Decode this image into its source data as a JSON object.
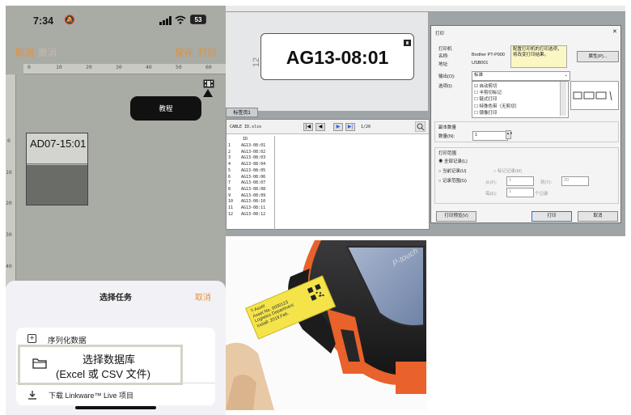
{
  "phone": {
    "status": {
      "time": "7:34",
      "battery": "53"
    },
    "toolbar": {
      "cancel": "取消",
      "undo": "撤消",
      "save": "保存",
      "print": "打印"
    },
    "ruler_h": [
      "0",
      "10",
      "20",
      "30",
      "40",
      "50",
      "60"
    ],
    "ruler_v": [
      "0",
      "10",
      "20",
      "30",
      "40"
    ],
    "tooltip": "教程",
    "label_text": "AD07-15:01",
    "sheet": {
      "title": "选择任务",
      "cancel": "取消",
      "options": [
        {
          "label": "序列化数据"
        },
        {
          "label": "选择数据库",
          "sub": "(Excel 或 CSV 文件)"
        },
        {
          "label": "下载 Linkware™ Live 项目"
        }
      ]
    }
  },
  "desktop": {
    "ruler_num": "12",
    "label_text": "AG13-08:01",
    "tab": "标签页1",
    "file_name": "CABLE ID.xlsx",
    "page_counter": "1/20",
    "table": {
      "header": "ID",
      "rows": [
        [
          "1",
          "AG13-08:01"
        ],
        [
          "2",
          "AG13-08:02"
        ],
        [
          "3",
          "AG13-08:03"
        ],
        [
          "4",
          "AG13-08:04"
        ],
        [
          "5",
          "AG13-08:05"
        ],
        [
          "6",
          "AG13-08:06"
        ],
        [
          "7",
          "AG13-08:07"
        ],
        [
          "8",
          "AG13-08:08"
        ],
        [
          "9",
          "AG13-08:09"
        ],
        [
          "10",
          "AG13-08:10"
        ],
        [
          "11",
          "AG13-08:11"
        ],
        [
          "12",
          "AG13-08:12"
        ]
      ]
    },
    "dialog": {
      "title": "打印",
      "printer_section": "打印机",
      "name_label": "名称:",
      "name_value": "Brother PT-P900",
      "addr_label": "地址:",
      "addr_value": "USB001",
      "note": "配置打印机的打印选项，将改变打印结果。",
      "properties_btn": "属性(P)...",
      "output_label": "输出(O):",
      "output_value": "标准",
      "options_label": "选项(I):",
      "options": [
        "自动剪切",
        "半剪切标记",
        "链式打印",
        "特殊色带（无剪切）",
        "镜像打印"
      ],
      "copies_section": "副本数量",
      "copies_label": "数量(N):",
      "copies_value": "1",
      "range_section": "打印范围",
      "range_all": "全部记录(L)",
      "range_current": "当前记录(U)",
      "range_marked": "标记记录(M)",
      "range_records": "记录范围(G)",
      "from_label": "从(F):",
      "from_value": "1",
      "to_label": "到(T):",
      "to_value": "20",
      "each_label": "每(E):",
      "each_value": "1",
      "each_unit": "个记录",
      "preview_btn": "打印预览(V)",
      "print_btn": "打印",
      "cancel_btn": "取消"
    }
  },
  "photo": {
    "device_brand": "P-touch",
    "label_lines": [
      "T-Asset",
      "Asset No. 0000123",
      "Logistics Department",
      "Install: 2019.Feb."
    ]
  },
  "colors": {
    "accent": "#e2913b",
    "phone_bg": "#a9aba5",
    "desk_bg": "#9fa4a6",
    "label_yellow": "#f4e44a",
    "device_orange": "#e9612b"
  }
}
